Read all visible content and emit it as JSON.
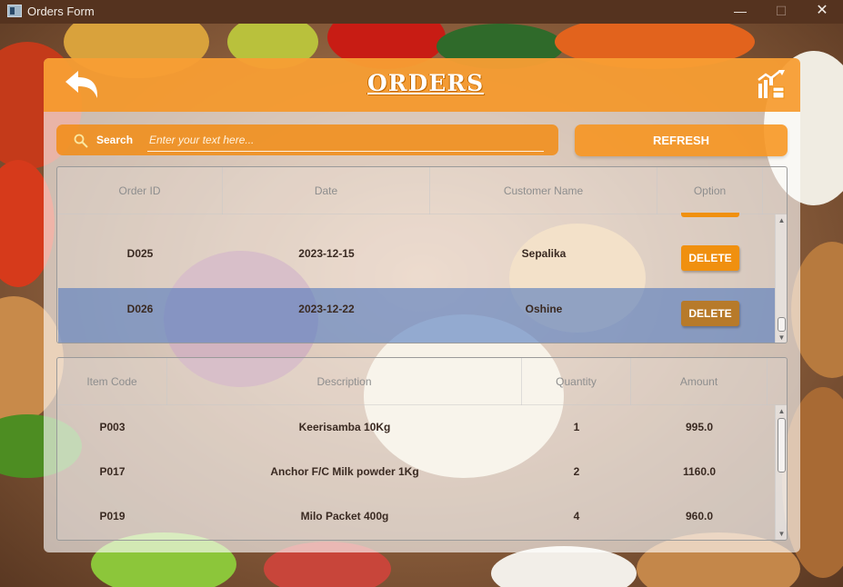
{
  "window": {
    "title": "Orders Form",
    "minimize": "—",
    "maximize": "☐",
    "close": "✕"
  },
  "header": {
    "title": "ORDERS",
    "back_icon": "back-arrow-icon",
    "report_icon": "report-chart-icon"
  },
  "search": {
    "label": "Search",
    "placeholder": "Enter your text here...",
    "value": ""
  },
  "refresh_label": "REFRESH",
  "orders_table": {
    "columns": [
      "Order ID",
      "Date",
      "Customer Name",
      "Option"
    ],
    "rows": [
      {
        "order_id": "D025",
        "date": "2023-12-15",
        "customer": "Sepalika",
        "option": "DELETE"
      },
      {
        "order_id": "D026",
        "date": "2023-12-22",
        "customer": "Oshine",
        "option": "DELETE"
      }
    ],
    "selected_row": "D026"
  },
  "items_table": {
    "columns": [
      "Item Code",
      "Description",
      "Quantity",
      "Amount"
    ],
    "rows": [
      {
        "code": "P003",
        "description": "Keerisamba 10Kg",
        "quantity": "1",
        "amount": "995.0"
      },
      {
        "code": "P017",
        "description": "Anchor F/C Milk powder 1Kg",
        "quantity": "2",
        "amount": "1160.0"
      },
      {
        "code": "P019",
        "description": "Milo Packet 400g",
        "quantity": "4",
        "amount": "960.0"
      }
    ]
  },
  "colors": {
    "accent": "#f7941e",
    "selection": "#5078be",
    "titlebar": "#55331f"
  }
}
